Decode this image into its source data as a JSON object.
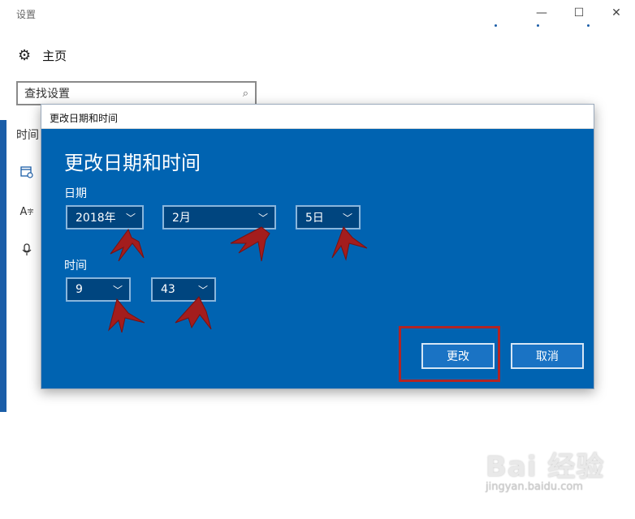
{
  "window": {
    "title": "设置",
    "minimize": "—",
    "maximize": "☐",
    "close": "✕"
  },
  "nav": {
    "home_icon": "gear-icon",
    "home_label": "主页",
    "section_heading": "时间"
  },
  "search": {
    "value": "查找设置",
    "icon": "search-icon"
  },
  "sidebar_icons": [
    "calendar-clock-icon",
    "language-icon",
    "microphone-icon"
  ],
  "dialog": {
    "titlebar": "更改日期和时间",
    "heading": "更改日期和时间",
    "date_label": "日期",
    "time_label": "时间",
    "year": "2018年",
    "month": "2月",
    "day": "5日",
    "hour": "9",
    "minute": "43",
    "change_button": "更改",
    "cancel_button": "取消"
  },
  "annotation_color": "#b32424",
  "dialog_bg": "#0063b1",
  "watermark": {
    "logo": "Bai 经验",
    "url": "jingyan.baidu.com"
  }
}
